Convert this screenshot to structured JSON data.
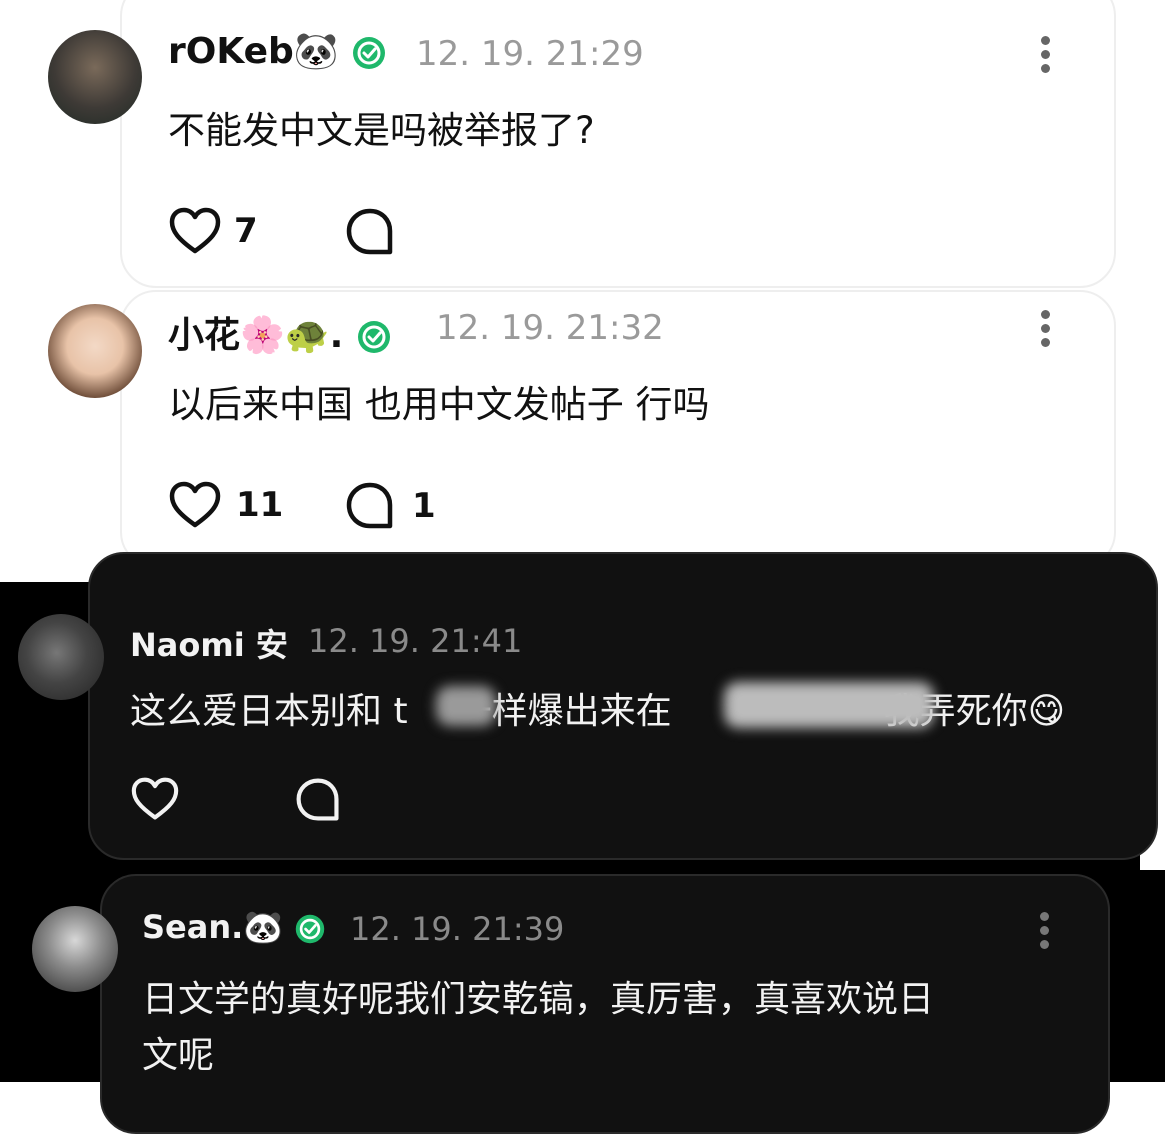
{
  "comments": [
    {
      "username": "rOKeb",
      "emoji": "🐼",
      "timestamp": "12. 19. 21:29",
      "text": "不能发中文是吗被举报了?",
      "likes": "7",
      "replies": ""
    },
    {
      "username": "小花",
      "emoji": "🌸🐢.",
      "timestamp": "12. 19. 21:32",
      "text": "以后来中国 也用中文发帖子 行吗",
      "likes": "11",
      "replies": "1"
    },
    {
      "username": "Naomi 安",
      "emoji": "",
      "timestamp": "12. 19. 21:41",
      "text_parts": [
        "这么爱日本别和 t",
        "一样爆出来在",
        "我弄死你",
        "😋"
      ],
      "likes": "",
      "replies": ""
    },
    {
      "username": "Sean.",
      "emoji": "🐼",
      "timestamp": "12. 19. 21:39",
      "text_line1": "日文学的真好呢我们安乾镐，真厉害，真喜欢说日",
      "text_line2": "文呢"
    }
  ],
  "colors": {
    "verified_badge": "#1fb86b",
    "dark_card": "#111111",
    "light_card": "#ffffff"
  },
  "icons": {
    "like": "heart-outline-icon",
    "reply": "speech-bubble-icon",
    "more": "more-vertical-icon",
    "verified": "verified-check-icon"
  }
}
